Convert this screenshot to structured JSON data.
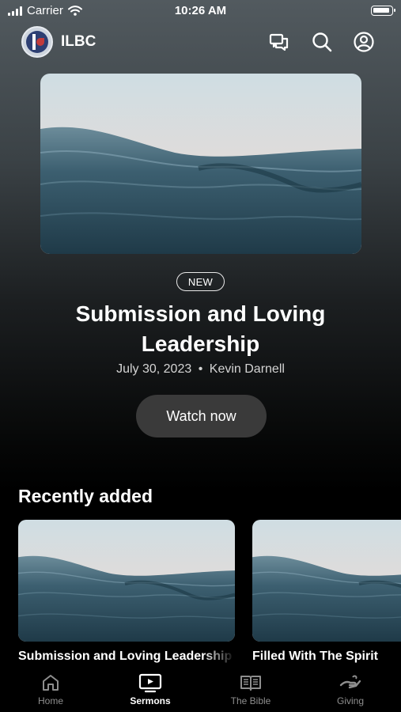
{
  "status_bar": {
    "carrier": "Carrier",
    "time": "10:26 AM"
  },
  "header": {
    "brand": "ILBC"
  },
  "hero": {
    "badge": "NEW",
    "title": "Submission and Loving Leadership",
    "date": "July 30, 2023",
    "speaker": "Kevin Darnell",
    "separator": "•",
    "cta": "Watch now"
  },
  "recent": {
    "title": "Recently added",
    "items": [
      {
        "title": "Submission and Loving Leadership"
      },
      {
        "title": "Filled With The Spirit"
      }
    ]
  },
  "tabs": [
    {
      "label": "Home",
      "icon": "home-icon",
      "active": false
    },
    {
      "label": "Sermons",
      "icon": "tv-play-icon",
      "active": true
    },
    {
      "label": "The Bible",
      "icon": "book-icon",
      "active": false
    },
    {
      "label": "Giving",
      "icon": "giving-hand-icon",
      "active": false
    }
  ],
  "colors": {
    "accent": "#ffffff",
    "button_bg": "#3a3a3a",
    "inactive_tab": "#8e8e8e"
  }
}
